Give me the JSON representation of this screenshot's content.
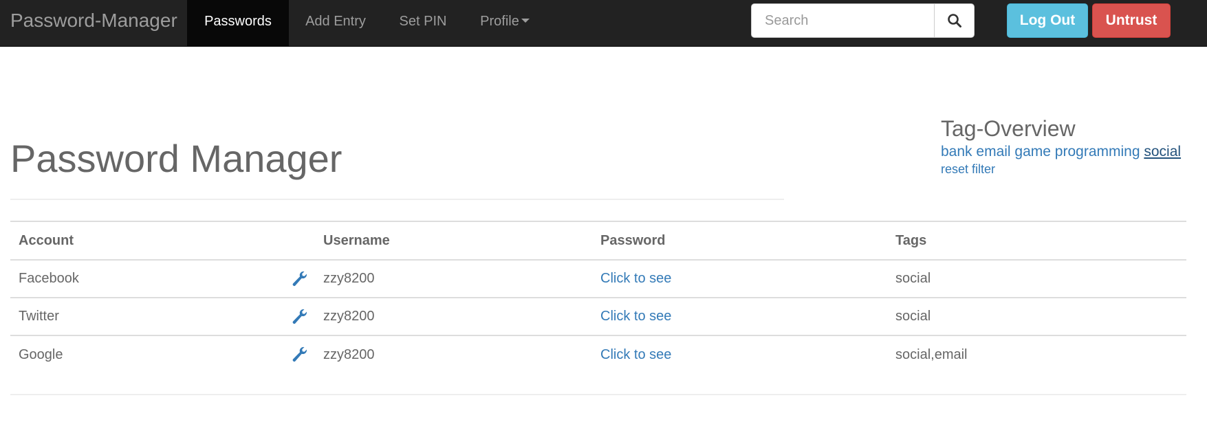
{
  "navbar": {
    "brand": "Password-Manager",
    "items": [
      {
        "label": "Passwords",
        "active": true
      },
      {
        "label": "Add Entry",
        "active": false
      },
      {
        "label": "Set PIN",
        "active": false
      },
      {
        "label": "Profile",
        "active": false,
        "dropdown": true
      }
    ],
    "search": {
      "placeholder": "Search",
      "value": "",
      "icon": "search-icon"
    },
    "buttons": {
      "logout": "Log Out",
      "untrust": "Untrust"
    }
  },
  "main": {
    "title": "Password Manager",
    "tag_overview": {
      "title": "Tag-Overview",
      "tags": [
        "bank",
        "email",
        "game",
        "programming",
        "social"
      ],
      "active_tag": "social",
      "reset_label": "reset filter"
    },
    "table": {
      "headers": [
        "Account",
        "Username",
        "Password",
        "Tags"
      ],
      "rows": [
        {
          "account": "Facebook",
          "username": "zzy8200",
          "password": "Click to see",
          "tags": "social",
          "edit_icon": "wrench-icon"
        },
        {
          "account": "Twitter",
          "username": "zzy8200",
          "password": "Click to see",
          "tags": "social",
          "edit_icon": "wrench-icon"
        },
        {
          "account": "Google",
          "username": "zzy8200",
          "password": "Click to see",
          "tags": "social,email",
          "edit_icon": "wrench-icon"
        }
      ]
    }
  },
  "colors": {
    "navbar_bg": "#222222",
    "link": "#337ab7",
    "info": "#5bc0de",
    "danger": "#d9534f"
  }
}
